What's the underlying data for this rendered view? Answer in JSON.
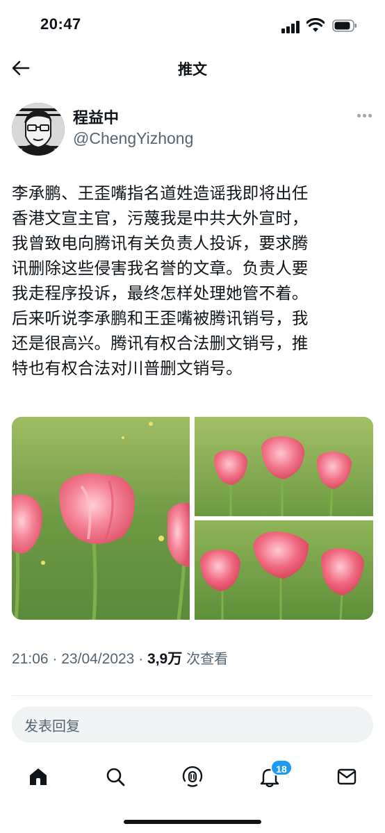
{
  "status_bar": {
    "time": "20:47"
  },
  "header": {
    "title": "推文"
  },
  "author": {
    "name": "程益中",
    "handle": "@ChengYizhong"
  },
  "tweet": {
    "lines": [
      "李承鹏、王歪嘴指名道姓造谣我即将出任",
      "香港文宣主官，污蔑我是中共大外宣时，",
      "我曾致电向腾讯有关负责人投诉，要求腾",
      "讯删除这些侵害我名誉的文章。负责人要",
      "我走程序投诉，最终怎样处理她管不着。",
      "后来听说李承鹏和王歪嘴被腾讯销号，我",
      "还是很高兴。腾讯有权合法删文销号，推",
      "特也有权合法对川普删文销号。"
    ]
  },
  "meta": {
    "time": "21:06",
    "sep": "·",
    "date": "23/04/2023",
    "views_count": "3,9万",
    "views_label": "次查看"
  },
  "reply": {
    "placeholder": "发表回复"
  },
  "tabbar": {
    "items": [
      "home-icon",
      "search-icon",
      "spaces-icon",
      "notifications-icon",
      "messages-icon"
    ],
    "notifications_badge": "18"
  },
  "colors": {
    "accent": "#1d9bf0",
    "text": "#0f1419",
    "secondary": "#536471",
    "grass": "#6f9a45",
    "tulip": "#f06a7e"
  }
}
